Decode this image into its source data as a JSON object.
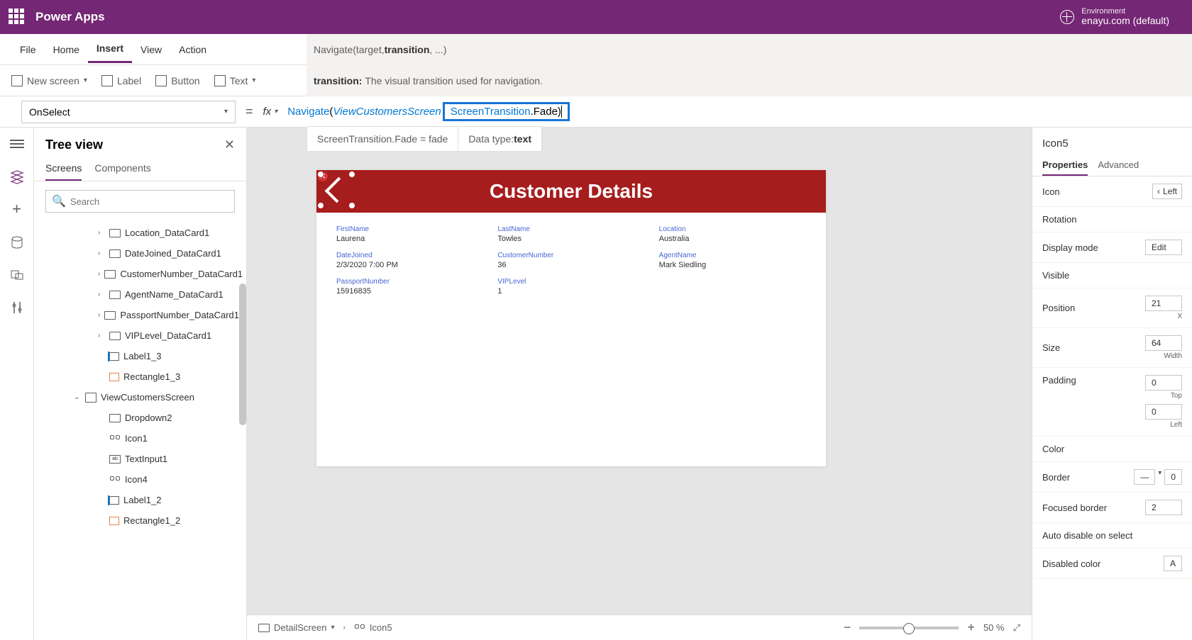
{
  "app_title": "Power Apps",
  "environment": {
    "label": "Environment",
    "value": "enayu.com (default)"
  },
  "menu": {
    "file": "File",
    "home": "Home",
    "insert": "Insert",
    "view": "View",
    "action": "Action"
  },
  "formula_signature_pre": "Navigate(target, ",
  "formula_signature_bold": "transition",
  "formula_signature_post": ", ...)",
  "param_help_label": "transition:",
  "param_help_desc": "The visual transition used for navigation.",
  "ribbon": {
    "new_screen": "New screen",
    "label": "Label",
    "button": "Button",
    "text": "Text"
  },
  "property_selector": "OnSelect",
  "formula": {
    "fn": "Navigate",
    "open": "(",
    "arg1": "ViewCustomersScreen",
    "arg2a": "ScreenTransition",
    "arg2b": ".Fade",
    "close": ")"
  },
  "formula_result_left": "ScreenTransition.Fade  =  fade",
  "formula_result_right_label": "Data type: ",
  "formula_result_right_value": "text",
  "tree": {
    "title": "Tree view",
    "tabs": {
      "screens": "Screens",
      "components": "Components"
    },
    "search_placeholder": "Search",
    "items": [
      {
        "label": "Location_DataCard1",
        "card": true
      },
      {
        "label": "DateJoined_DataCard1",
        "card": true
      },
      {
        "label": "CustomerNumber_DataCard1",
        "card": true
      },
      {
        "label": "AgentName_DataCard1",
        "card": true
      },
      {
        "label": "PassportNumber_DataCard1",
        "card": true
      },
      {
        "label": "VIPLevel_DataCard1",
        "card": true
      },
      {
        "label": "Label1_3",
        "kind": "label"
      },
      {
        "label": "Rectangle1_3",
        "kind": "rect"
      },
      {
        "label": "ViewCustomersScreen",
        "screen": true
      },
      {
        "label": "Dropdown2",
        "kind": "dropdown"
      },
      {
        "label": "Icon1",
        "kind": "ctrl"
      },
      {
        "label": "TextInput1",
        "kind": "abc"
      },
      {
        "label": "Icon4",
        "kind": "ctrl"
      },
      {
        "label": "Label1_2",
        "kind": "label"
      },
      {
        "label": "Rectangle1_2",
        "kind": "rect"
      }
    ]
  },
  "canvas": {
    "title": "Customer Details",
    "fields": [
      {
        "label": "FirstName",
        "value": "Laurena"
      },
      {
        "label": "LastName",
        "value": "Towles"
      },
      {
        "label": "Location",
        "value": "Australia"
      },
      {
        "label": "DateJoined",
        "value": "2/3/2020 7:00 PM"
      },
      {
        "label": "CustomerNumber",
        "value": "36"
      },
      {
        "label": "AgentName",
        "value": "Mark Siedling"
      },
      {
        "label": "PassportNumber",
        "value": "15916835"
      },
      {
        "label": "VIPLevel",
        "value": "1"
      }
    ]
  },
  "breadcrumb": {
    "screen": "DetailScreen",
    "selected": "Icon5"
  },
  "zoom": {
    "value": "50",
    "unit": "%"
  },
  "props": {
    "selected": "Icon5",
    "tabs": {
      "properties": "Properties",
      "advanced": "Advanced"
    },
    "rows": {
      "icon_label": "Icon",
      "icon_value": "Left",
      "rotation": "Rotation",
      "display_mode_label": "Display mode",
      "display_mode_value": "Edit",
      "visible": "Visible",
      "position_label": "Position",
      "position_x": "21",
      "position_x_sub": "X",
      "size_label": "Size",
      "size_w": "64",
      "size_w_sub": "Width",
      "padding_label": "Padding",
      "padding_top": "0",
      "padding_top_sub": "Top",
      "padding_left": "0",
      "padding_left_sub": "Left",
      "color": "Color",
      "border_label": "Border",
      "border_value": "—",
      "border_num": "0",
      "focused_label": "Focused border",
      "focused_val": "2",
      "auto_disable": "Auto disable on select",
      "disabled_color": "Disabled color",
      "disabled_val": "A"
    }
  }
}
